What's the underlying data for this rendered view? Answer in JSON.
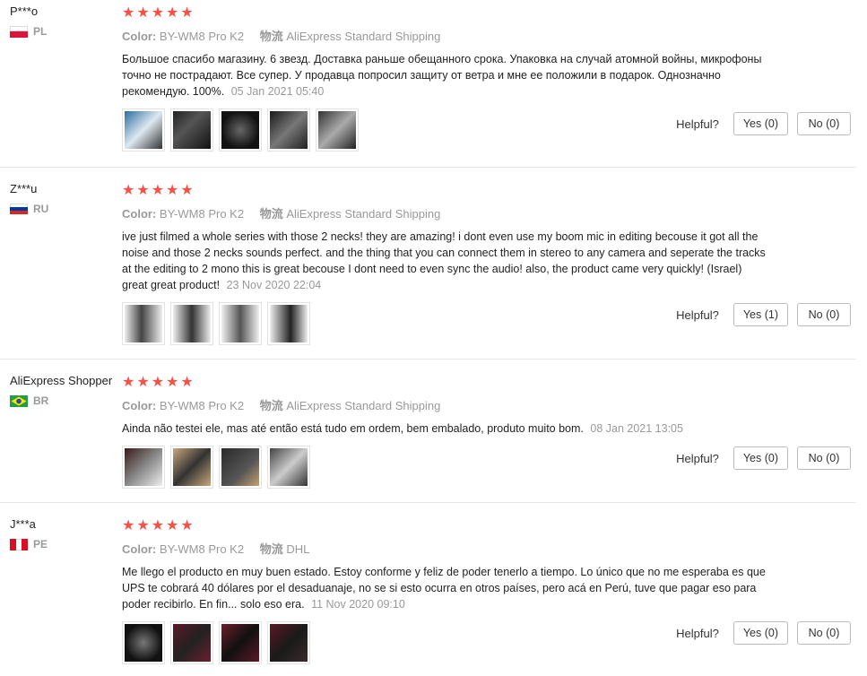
{
  "feedbacks": [
    {
      "user": "P***o",
      "country": "PL",
      "stars": 5,
      "color_label": "Color:",
      "color_value": "BY-WM8 Pro K2",
      "ship_label": "物流",
      "ship_value": "AliExpress Standard Shipping",
      "content": "Большое спасибо магазину. 6 звезд. Доставка раньше обещанного срока. Упаковка на случай атомной войны, микрофоны точно не пострадают. Все супер. У продавца попросил защиту от ветра и мне ее положили в подарок. Однозначно рекомендую. 100%.",
      "date": "05 Jan 2021 05:40",
      "photos": 5,
      "helpful_label": "Helpful?",
      "yes_label": "Yes (0)",
      "no_label": "No (0)"
    },
    {
      "user": "Z***u",
      "country": "RU",
      "stars": 5,
      "color_label": "Color:",
      "color_value": "BY-WM8 Pro K2",
      "ship_label": "物流",
      "ship_value": "AliExpress Standard Shipping",
      "content": "ive just filmed a whole series with those 2 necks! they are amazing! i dont even use my boom mic in editing becouse it got all the noise and those 2 necks sounds perfect. and the thing that you can connect them in stereo to any camera and seperate the tracks at the editing to 2 mono this is great becouse I dont need to even sync the audio! also, the product came very quickly! (Israel) great great product!",
      "date": "23 Nov 2020 22:04",
      "photos": 4,
      "helpful_label": "Helpful?",
      "yes_label": "Yes (1)",
      "no_label": "No (0)"
    },
    {
      "user": "AliExpress Shopper",
      "country": "BR",
      "stars": 5,
      "color_label": "Color:",
      "color_value": "BY-WM8 Pro K2",
      "ship_label": "物流",
      "ship_value": "AliExpress Standard Shipping",
      "content": "Ainda não testei ele, mas até então está tudo em ordem, bem embalado, produto muito bom.",
      "date": "08 Jan 2021 13:05",
      "photos": 4,
      "helpful_label": "Helpful?",
      "yes_label": "Yes (0)",
      "no_label": "No (0)"
    },
    {
      "user": "J***a",
      "country": "PE",
      "stars": 5,
      "color_label": "Color:",
      "color_value": "BY-WM8 Pro K2",
      "ship_label": "物流",
      "ship_value": "DHL",
      "content": "Me llego el producto en muy buen estado. Estoy conforme y feliz de poder tenerlo a tiempo. Lo único que no me esperaba es que UPS te cobrará 40 dólares por el desaduanaje, no se si esto ocurra en otros países, pero acá en Perú, tuve que pagar eso para poder recibirlo. En fin... solo eso era.",
      "date": "11 Nov 2020 09:10",
      "photos": 4,
      "helpful_label": "Helpful?",
      "yes_label": "Yes (0)",
      "no_label": "No (0)"
    }
  ],
  "colors": {
    "star": "#f45249",
    "muted": "#999999"
  }
}
